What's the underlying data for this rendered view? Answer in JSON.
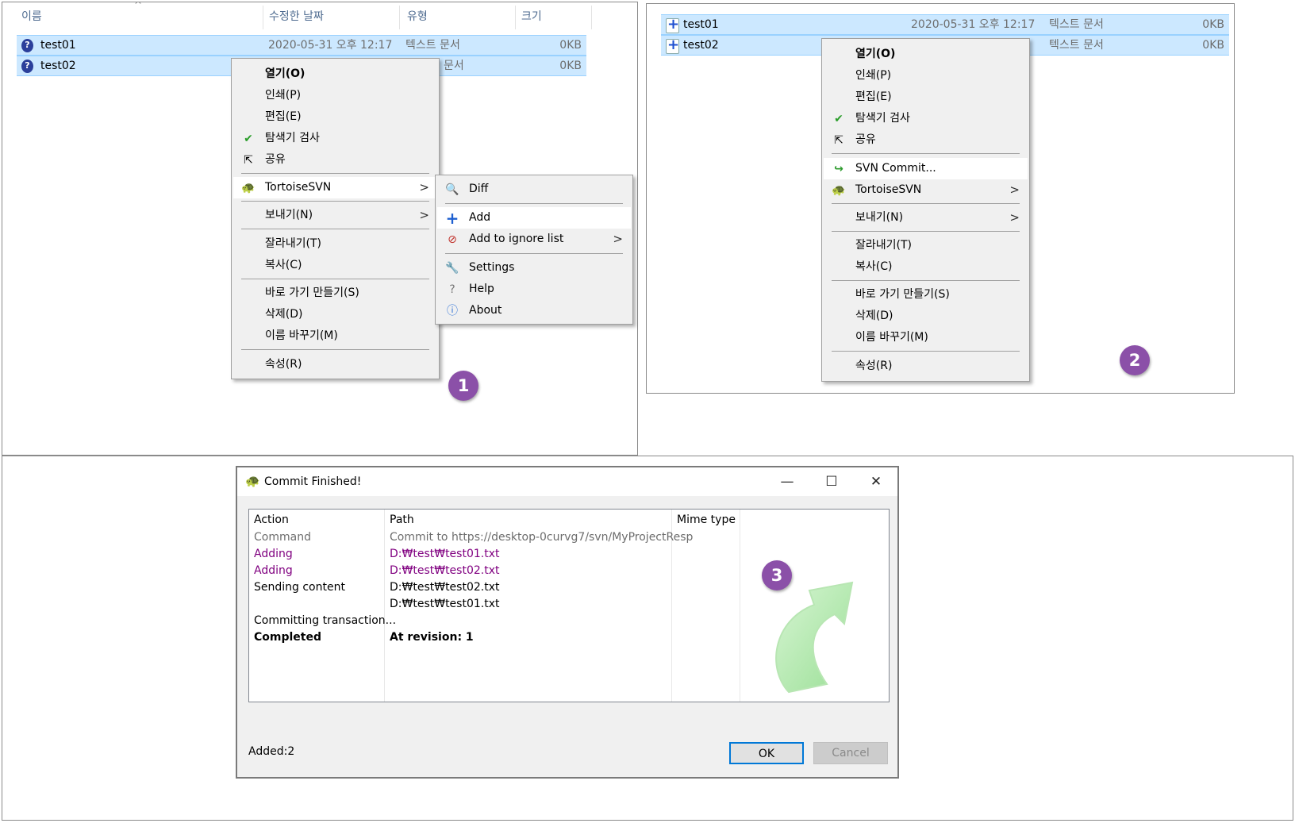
{
  "explorer1": {
    "columns": [
      "이름",
      "수정한 날짜",
      "유형",
      "크기"
    ],
    "files": [
      {
        "name": "test01",
        "date": "2020-05-31 오후 12:17",
        "type": "텍스트 문서",
        "size": "0KB"
      },
      {
        "name": "test02",
        "type": "문서",
        "size": "0KB"
      }
    ],
    "badge": "1"
  },
  "menu1": {
    "items": [
      "열기(O)",
      "인쇄(P)",
      "편집(E)",
      "탐색기 검사",
      "공유",
      "TortoiseSVN",
      "보내기(N)",
      "잘라내기(T)",
      "복사(C)",
      "바로 가기 만들기(S)",
      "삭제(D)",
      "이름 바꾸기(M)",
      "속성(R)"
    ]
  },
  "submenu1": {
    "items": [
      "Diff",
      "Add",
      "Add to ignore list",
      "Settings",
      "Help",
      "About"
    ]
  },
  "explorer2": {
    "files": [
      {
        "name": "test01",
        "date": "2020-05-31 오후 12:17",
        "type": "텍스트 문서",
        "size": "0KB"
      },
      {
        "name": "test02",
        "type": "텍스트 문서",
        "size": "0KB"
      }
    ],
    "badge": "2"
  },
  "menu2": {
    "items": [
      "열기(O)",
      "인쇄(P)",
      "편집(E)",
      "탐색기 검사",
      "공유",
      "SVN Commit...",
      "TortoiseSVN",
      "보내기(N)",
      "잘라내기(T)",
      "복사(C)",
      "바로 가기 만들기(S)",
      "삭제(D)",
      "이름 바꾸기(M)",
      "속성(R)"
    ]
  },
  "dialog": {
    "title": "Commit Finished!",
    "columns": [
      "Action",
      "Path",
      "Mime type"
    ],
    "rows": [
      {
        "action": "Command",
        "path": "Commit to https://desktop-0curvg7/svn/MyProjectResp"
      },
      {
        "action": "Adding",
        "path": "D:₩test₩test01.txt"
      },
      {
        "action": "Adding",
        "path": "D:₩test₩test02.txt"
      },
      {
        "action": "Sending content",
        "path": "D:₩test₩test02.txt"
      },
      {
        "action": "",
        "path": "D:₩test₩test01.txt"
      },
      {
        "action": "Committing transaction...",
        "path": ""
      },
      {
        "action": "Completed",
        "path": "At revision: 1"
      }
    ],
    "status": "Added:2",
    "ok_label": "OK",
    "cancel_label": "Cancel",
    "badge": "3"
  },
  "colors": {
    "selection": "#cce8ff",
    "badge": "#8b50a8",
    "adding_text": "#800080",
    "command_text": "#6d6d6d"
  }
}
